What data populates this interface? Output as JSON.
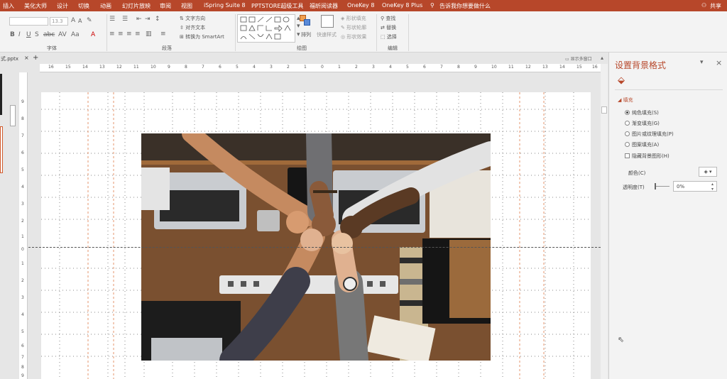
{
  "menu": {
    "items": [
      "插入",
      "美化大师",
      "设计",
      "切换",
      "动画",
      "幻灯片放映",
      "审阅",
      "视图",
      "iSpring Suite 8",
      "PPTSTORE超级工具",
      "福昕阅读器",
      "OneKey 8",
      "OneKey 8 Plus"
    ],
    "search_placeholder": "告诉我你想要做什么",
    "share": "共享"
  },
  "ribbon": {
    "font_size": "13.3",
    "text_direction": "文字方向",
    "align_text": "对齐文本",
    "smartart": "转换为 SmartArt",
    "arrange": "排列",
    "quick_styles": "快速样式",
    "shape_fill": "形状填充",
    "shape_outline": "形状轮廓",
    "shape_effects": "形状效果",
    "find": "查找",
    "replace": "替换",
    "select": "选择",
    "groups": {
      "font": "字体",
      "paragraph": "段落",
      "drawing": "绘图",
      "editing": "编辑"
    }
  },
  "tabstrip": {
    "file": "式.pptx",
    "close": "×",
    "add": "+",
    "notes": "显示多窗口"
  },
  "ruler": {
    "h_ticks": [
      "16",
      "15",
      "14",
      "13",
      "12",
      "11",
      "10",
      "9",
      "8",
      "7",
      "6",
      "5",
      "4",
      "3",
      "2",
      "1",
      "0",
      "1",
      "2",
      "3",
      "4",
      "5",
      "6",
      "7",
      "8",
      "9",
      "10",
      "11",
      "12",
      "13",
      "14",
      "15",
      "16"
    ],
    "v_ticks": [
      "9",
      "8",
      "7",
      "6",
      "5",
      "4",
      "3",
      "2",
      "1",
      "0",
      "1",
      "2",
      "3",
      "4",
      "5",
      "6",
      "7",
      "8",
      "9"
    ]
  },
  "pane": {
    "title": "设置背景格式",
    "section": "填充",
    "options": [
      {
        "label": "纯色填充(S)",
        "checked": true
      },
      {
        "label": "渐变填充(G)",
        "checked": false
      },
      {
        "label": "图片或纹理填充(P)",
        "checked": false
      },
      {
        "label": "图案填充(A)",
        "checked": false
      }
    ],
    "hide_bg": "隐藏背景图形(H)",
    "color_label": "颜色(C)",
    "transparency_label": "透明度(T)",
    "transparency_value": "0%"
  },
  "colors": {
    "accent": "#b7472a",
    "menubar": "#b7472a",
    "ribbon": "#f3f3f3",
    "guide": "#e07a4a"
  }
}
